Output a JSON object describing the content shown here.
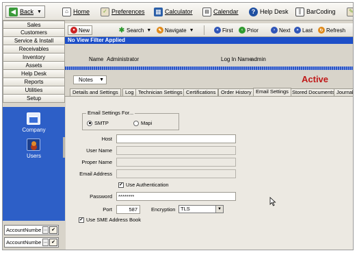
{
  "toolbar": {
    "back": "Back",
    "home": "Home",
    "preferences": "Preferences",
    "calculator": "Calculator",
    "calendar": "Calendar",
    "help_desk": "Help Desk",
    "barcoding": "BarCoding"
  },
  "nav": {
    "items": [
      "Sales",
      "Customers",
      "Service & Install",
      "Receivables",
      "Inventory",
      "Assets",
      "Help Desk",
      "Reports",
      "Utilities",
      "Setup"
    ],
    "panel": {
      "company": "Company",
      "users": "Users"
    },
    "account_fields": [
      "AccountNumbe",
      "AccountNumbe"
    ]
  },
  "record_toolbar": {
    "new": "New",
    "search": "Search",
    "navigate": "Navigate",
    "first": "First",
    "prior": "Prior",
    "next": "Next",
    "last": "Last",
    "refresh": "Refresh"
  },
  "filter_text": "No View Filter Applied",
  "header": {
    "name_label": "Name",
    "name_value": "Administrator",
    "login_label": "Log In Name",
    "login_value": "admin"
  },
  "notes_dropdown": "Notes",
  "status": "Active",
  "status_color": "#c01818",
  "tabs": [
    "Details and Settings",
    "Log",
    "Technician Settings",
    "Certifications",
    "Order History",
    "Email Settings",
    "Stored Documents",
    "Journal"
  ],
  "active_tab": "Email Settings",
  "email": {
    "group_title": "Email Settings For...",
    "option_smtp": "SMTP",
    "option_mapi": "Mapi",
    "selected_option": "SMTP",
    "host_label": "Host",
    "host_value": "",
    "username_label": "User Name",
    "username_value": "",
    "propername_label": "Proper Name",
    "propername_value": "",
    "email_label": "Email Address",
    "email_value": "",
    "use_auth_label": "Use Authentication",
    "use_auth_checked": true,
    "password_label": "Password",
    "password_value": "********",
    "port_label": "Port",
    "port_value": "587",
    "encryption_label": "Encryption",
    "encryption_value": "TLS",
    "sme_label": "Use SME Address Book",
    "sme_checked": true
  },
  "colors": {
    "filter_bar": "#1d4fc8",
    "nav_panel": "#2d5fc7"
  }
}
